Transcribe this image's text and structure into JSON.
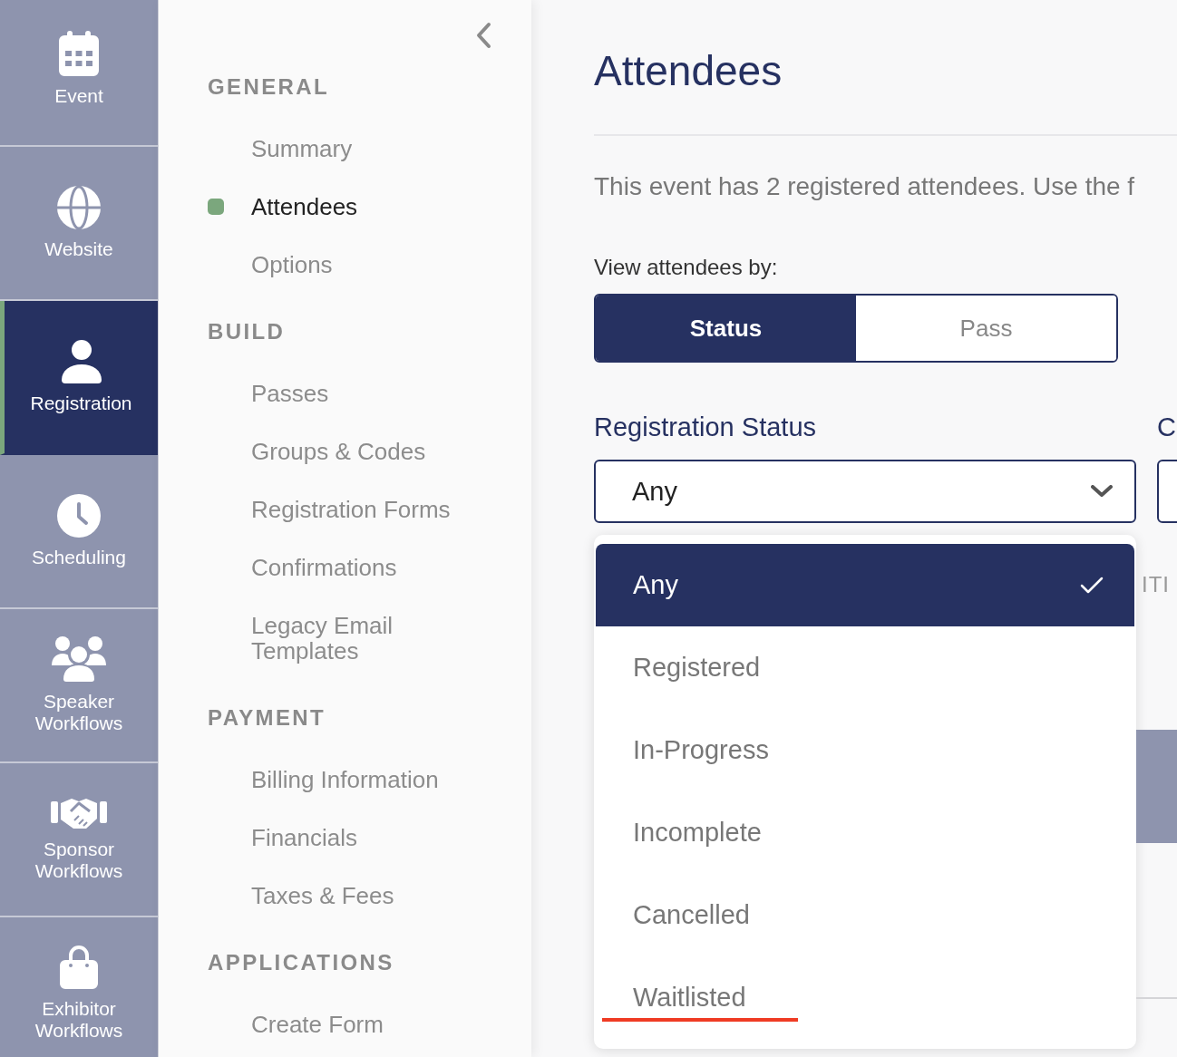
{
  "nav_rail": {
    "items": [
      {
        "kind": "calendar",
        "label": "Event",
        "selected": false
      },
      {
        "kind": "globe",
        "label": "Website",
        "selected": false
      },
      {
        "kind": "person",
        "label": "Registration",
        "selected": true
      },
      {
        "kind": "clock",
        "label": "Scheduling",
        "selected": false
      },
      {
        "kind": "people",
        "label": "Speaker Workflows",
        "selected": false
      },
      {
        "kind": "handshake",
        "label": "Sponsor Workflows",
        "selected": false
      },
      {
        "kind": "bag",
        "label": "Exhibitor Workflows",
        "selected": false
      }
    ]
  },
  "sidebar": {
    "sections": [
      {
        "title": "GENERAL",
        "items": [
          {
            "label": "Summary",
            "selected": false
          },
          {
            "label": "Attendees",
            "selected": true
          },
          {
            "label": "Options",
            "selected": false
          }
        ]
      },
      {
        "title": "BUILD",
        "items": [
          {
            "label": "Passes",
            "selected": false
          },
          {
            "label": "Groups & Codes",
            "selected": false
          },
          {
            "label": "Registration Forms",
            "selected": false
          },
          {
            "label": "Confirmations",
            "selected": false
          },
          {
            "label": "Legacy Email Templates",
            "selected": false
          }
        ]
      },
      {
        "title": "PAYMENT",
        "items": [
          {
            "label": "Billing Information",
            "selected": false
          },
          {
            "label": "Financials",
            "selected": false
          },
          {
            "label": "Taxes & Fees",
            "selected": false
          }
        ]
      },
      {
        "title": "APPLICATIONS",
        "items": [
          {
            "label": "Create Form",
            "selected": false
          }
        ]
      }
    ]
  },
  "main": {
    "title": "Attendees",
    "description": "This event has 2 registered attendees. Use the f",
    "view_by": {
      "label": "View attendees by:",
      "options": [
        {
          "label": "Status",
          "selected": true
        },
        {
          "label": "Pass",
          "selected": false
        }
      ]
    },
    "filters": [
      {
        "label": "Registration Status",
        "value": "Any",
        "expanded": true,
        "options": [
          {
            "label": "Any",
            "selected": true,
            "annotated": false
          },
          {
            "label": "Registered",
            "selected": false,
            "annotated": false
          },
          {
            "label": "In-Progress",
            "selected": false,
            "annotated": false
          },
          {
            "label": "Incomplete",
            "selected": false,
            "annotated": false
          },
          {
            "label": "Cancelled",
            "selected": false,
            "annotated": false
          },
          {
            "label": "Waitlisted",
            "selected": false,
            "annotated": true
          }
        ]
      },
      {
        "label": "C"
      }
    ],
    "partial_text": "ITI"
  }
}
